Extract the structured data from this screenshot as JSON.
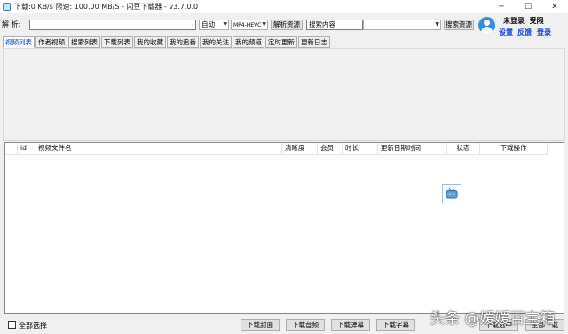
{
  "window": {
    "title": "下载:0 KB/s  限速: 100.00 MB/S  - 闪豆下载器 - v3.7.0.0",
    "min_icon": "─",
    "max_icon": "☐",
    "close_icon": "✕"
  },
  "toolbar": {
    "parse_label": "解 析:",
    "url_value": "",
    "quality_select": "自动",
    "format_select": "MP4-HEVC",
    "parse_button": "解析资源",
    "search_input": "搜索内容",
    "search_select": "",
    "search_button": "搜索资源"
  },
  "user": {
    "status": "未登录",
    "permission": "受限",
    "settings": "设置",
    "feedback": "反馈",
    "login": "登录"
  },
  "tabs": [
    "视频列表",
    "作者视频",
    "搜索列表",
    "下载列表",
    "我的收藏",
    "我的追番",
    "我的关注",
    "我的频道",
    "定时更新",
    "更新日志"
  ],
  "table": {
    "columns": [
      "id",
      "视频文件名",
      "清晰度",
      "会员",
      "时长",
      "更新日期时间",
      "状态",
      "下载操作"
    ]
  },
  "bottom": {
    "select_all": "全部选择",
    "btn_cover": "下载封面",
    "btn_audio": "下载音频",
    "btn_danmaku": "下载弹幕",
    "btn_subtitle": "下载字幕",
    "btn_selected": "下载选中",
    "btn_all": "全部下载"
  },
  "watermark": "头条 @嫒嫒百宝箱"
}
